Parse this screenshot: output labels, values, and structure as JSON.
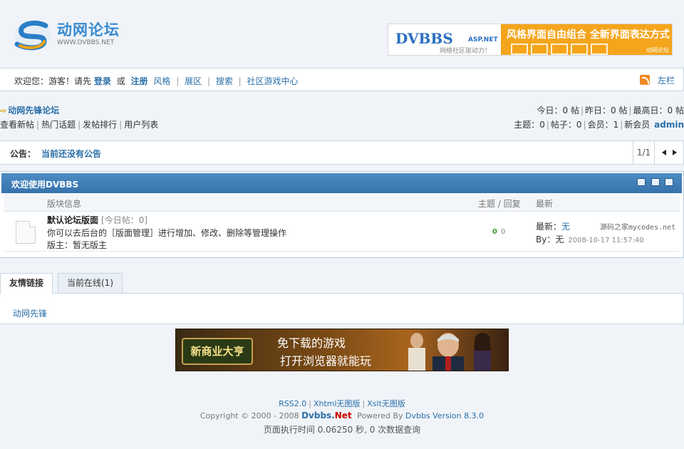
{
  "header": {
    "logo_title": "动网论坛",
    "logo_url": "WWW.DVBBS.NET",
    "banner": {
      "brand": "DVBBS",
      "brand_suffix": "ASP.NET",
      "brand_sub": "网络社区驱动力！",
      "slogan": "风格界面自由组合  全新界面表达方式",
      "tag": "动网论坛"
    }
  },
  "nav": {
    "welcome": "欢迎您：游客！请先",
    "login": "登录",
    "or": "或",
    "register": "注册",
    "links": [
      "风格",
      "展区",
      "搜索",
      "社区游戏中心"
    ],
    "sidebar_toggle": "左栏"
  },
  "crumb": {
    "title": "动网先锋论坛",
    "links": [
      "查看新帖",
      "热门话题",
      "发帖排行",
      "用户列表"
    ]
  },
  "stats": {
    "line1": [
      "今日：0 帖",
      "昨日：0 帖",
      "最高日：0 帖"
    ],
    "line2": [
      "主题：0",
      "帖子：0",
      "会员：1",
      "新会员"
    ],
    "newest_member": "admin"
  },
  "announcement": {
    "label": "公告：",
    "text": "当前还没有公告",
    "page": "1/1"
  },
  "forum": {
    "title": "欢迎使用DVBBS",
    "col_forum": "版块信息",
    "col_topics": "主题 / 回复",
    "col_latest": "最新",
    "board": {
      "name": "默认论坛版面",
      "today": "[今日帖：0]",
      "desc": "你可以去后台的［版面管理］进行增加、修改、删除等管理操作",
      "moderator": "版主：暂无版主",
      "topics": "0",
      "posts": "0",
      "latest_label": "最新：",
      "latest_value": "无",
      "by_label": "By：",
      "by_value": "无",
      "latest_date": "2008-10-17 11:57:40",
      "watermark": "源码之家mycodes.net"
    }
  },
  "tabs": {
    "items": [
      "友情链接",
      "当前在线(1)"
    ],
    "panel_link": "动网先锋"
  },
  "game_banner": {
    "logo_text": "新商业大亨",
    "line1": "免下载的游戏",
    "line2": "打开浏览器就能玩"
  },
  "footer": {
    "links": [
      "RSS2.0",
      "Xhtml无图版",
      "Xslt无图版"
    ],
    "copyright": "Copyright © 2000 - 2008",
    "brand": "Dvbbs.",
    "brand_net": "Net",
    "powered_label": "Powered By",
    "powered_value": "Dvbbs Version 8.3.0",
    "exec_time": "页面执行时间 0.06250 秒, 0 次数据查询"
  }
}
